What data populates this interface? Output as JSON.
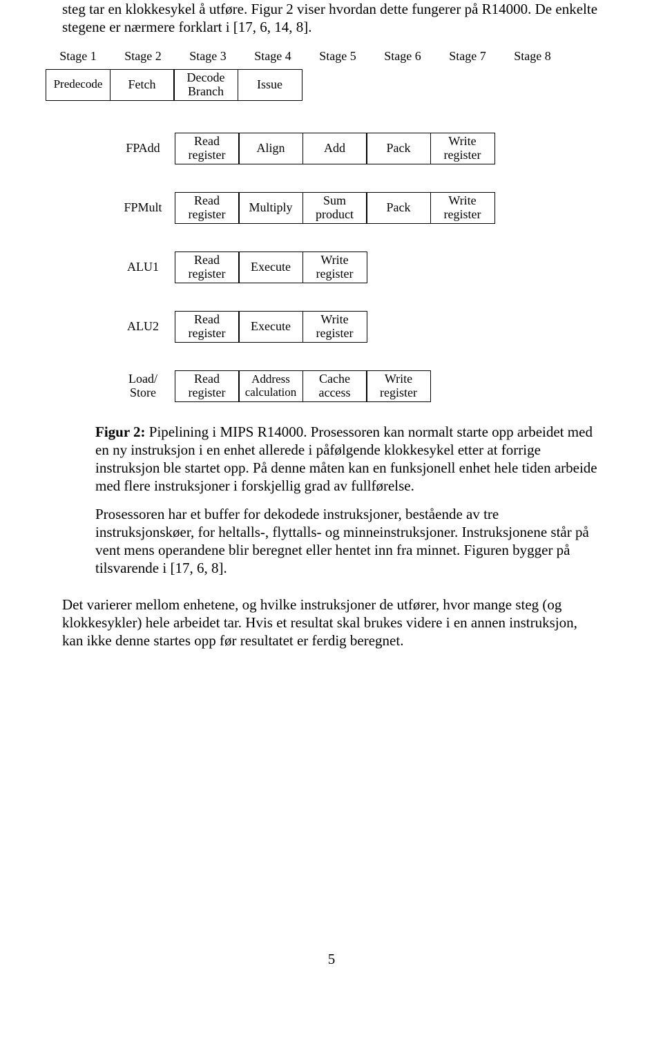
{
  "intro": "steg tar en klokkesykel å utføre. Figur 2 viser hvordan dette fungerer på R14000. De enkelte stegene er nærmere forklart i [17, 6, 14, 8].",
  "stages": {
    "s1": "Stage 1",
    "s2": "Stage 2",
    "s3": "Stage 3",
    "s4": "Stage 4",
    "s5": "Stage 5",
    "s6": "Stage 6",
    "s7": "Stage 7",
    "s8": "Stage 8"
  },
  "row0": {
    "c1": "Predecode",
    "c2": "Fetch",
    "c3a": "Decode",
    "c3b": "Branch",
    "c4": "Issue"
  },
  "fpadd": {
    "name": "FPAdd",
    "c1a": "Read",
    "c1b": "register",
    "c2": "Align",
    "c3": "Add",
    "c4": "Pack",
    "c5a": "Write",
    "c5b": "register"
  },
  "fpmult": {
    "name": "FPMult",
    "c1a": "Read",
    "c1b": "register",
    "c2": "Multiply",
    "c3a": "Sum",
    "c3b": "product",
    "c4": "Pack",
    "c5a": "Write",
    "c5b": "register"
  },
  "alu1": {
    "name": "ALU1",
    "c1a": "Read",
    "c1b": "register",
    "c2": "Execute",
    "c3a": "Write",
    "c3b": "register"
  },
  "alu2": {
    "name": "ALU2",
    "c1a": "Read",
    "c1b": "register",
    "c2": "Execute",
    "c3a": "Write",
    "c3b": "register"
  },
  "ls": {
    "name_a": "Load/",
    "name_b": "Store",
    "c1a": "Read",
    "c1b": "register",
    "c2a": "Address",
    "c2b": "calculation",
    "c3a": "Cache",
    "c3b": "access",
    "c4a": "Write",
    "c4b": "register"
  },
  "caption": {
    "label": "Figur 2:",
    "p1": " Pipelining i MIPS R14000. Prosessoren kan normalt starte opp arbeidet med en ny instruksjon i en enhet allerede i påfølgende klokkesykel etter at forrige instruksjon ble startet opp. På denne måten kan en funksjonell enhet hele tiden arbeide med flere instruksjoner i forskjellig grad av fullførelse.",
    "p2": "Prosessoren har et buffer for dekodede instruksjoner, bestående av tre instruksjonskøer, for heltalls-, flyttalls- og minneinstruksjoner. Instruksjonene står på vent mens operandene blir beregnet eller hentet inn fra minnet. Figuren bygger på tilsvarende i [17, 6, 8]."
  },
  "outro": "Det varierer mellom enhetene, og hvilke instruksjoner de utfører, hvor mange steg (og klokkesykler) hele arbeidet tar. Hvis et resultat skal brukes videre i en annen instruksjon, kan ikke denne startes opp før resultatet er ferdig beregnet.",
  "page": "5"
}
